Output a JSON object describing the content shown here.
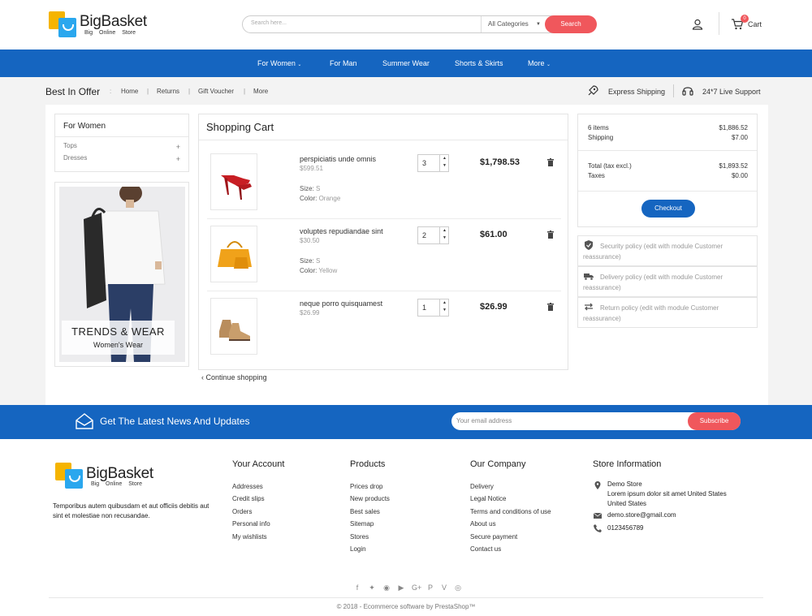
{
  "header": {
    "logo_title": "BigBasket",
    "logo_sub": "Big  Online Store",
    "search_placeholder": "Search here...",
    "search_category": "All Categories",
    "search_button": "Search",
    "cart_count": "0",
    "cart_label": "Cart"
  },
  "nav": [
    "For Women",
    "For Man",
    "Summer Wear",
    "Shorts & Skirts",
    "More"
  ],
  "breadcrumb": {
    "title": "Best In Offer",
    "items": [
      "Home",
      "Returns",
      "Gift Voucher",
      "More"
    ],
    "features": [
      "Express Shipping",
      "24*7 Live Support"
    ]
  },
  "categories": {
    "title": "For Women",
    "items": [
      "Tops",
      "Dresses"
    ]
  },
  "promo": {
    "title": "TRENDS & WEAR",
    "subtitle": "Women's Wear"
  },
  "cart": {
    "title": "Shopping Cart",
    "items": [
      {
        "name": "perspiciatis unde omnis",
        "price": "$599.51",
        "size_label": "Size:",
        "size": "S",
        "color_label": "Color:",
        "color": "Orange",
        "qty": "3",
        "total": "$1,798.53"
      },
      {
        "name": "voluptes repudiandae sint",
        "price": "$30.50",
        "size_label": "Size:",
        "size": "S",
        "color_label": "Color:",
        "color": "Yellow",
        "qty": "2",
        "total": "$61.00"
      },
      {
        "name": "neque porro quisquamest",
        "price": "$26.99",
        "qty": "1",
        "total": "$26.99"
      }
    ],
    "continue": "Continue shopping"
  },
  "summary": {
    "items_label": "6 items",
    "items_value": "$1,886.52",
    "shipping_label": "Shipping",
    "shipping_value": "$7.00",
    "total_label": "Total (tax excl.)",
    "total_value": "$1,893.52",
    "taxes_label": "Taxes",
    "taxes_value": "$0.00",
    "checkout": "Checkout"
  },
  "reassurance": [
    "Security policy (edit with module Customer reassurance)",
    "Delivery policy (edit with module Customer reassurance)",
    "Return policy (edit with module Customer reassurance)"
  ],
  "newsletter": {
    "title": "Get The Latest News And Updates",
    "placeholder": "Your email address",
    "button": "Subscribe"
  },
  "footer": {
    "description": "Temporibus autem quibusdam et aut officiis debitis aut sint et molestiae non recusandae.",
    "columns": [
      {
        "title": "Your Account",
        "links": [
          "Addresses",
          "Credit slips",
          "Orders",
          "Personal info",
          "My wishlists"
        ]
      },
      {
        "title": "Products",
        "links": [
          "Prices drop",
          "New products",
          "Best sales",
          "Sitemap",
          "Stores",
          "Login"
        ]
      },
      {
        "title": "Our Company",
        "links": [
          "Delivery",
          "Legal Notice",
          "Terms and conditions of use",
          "About us",
          "Secure payment",
          "Contact us"
        ]
      }
    ],
    "store": {
      "title": "Store Information",
      "name": "Demo Store",
      "address": "Lorem ipsum dolor sit amet United States",
      "country": "United States",
      "email": "demo.store@gmail.com",
      "phone": "0123456789"
    },
    "social": [
      "facebook-icon",
      "twitter-icon",
      "rss-icon",
      "youtube-icon",
      "google-plus-icon",
      "pinterest-icon",
      "vimeo-icon",
      "instagram-icon"
    ],
    "copyright": "© 2018 - Ecommerce software by PrestaShop™"
  },
  "colors": {
    "primary": "#1565c0",
    "accent": "#f0575c"
  }
}
